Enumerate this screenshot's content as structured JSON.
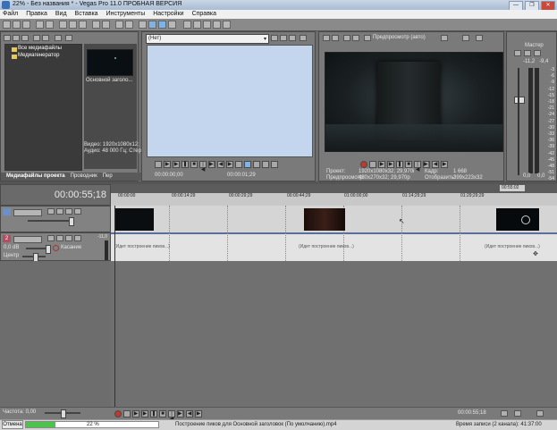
{
  "window": {
    "title": "22% - Без названия * - Vegas Pro 11.0 ПРОБНАЯ ВЕРСИЯ",
    "buttons": [
      "—",
      "❐",
      "✕"
    ]
  },
  "menu": [
    "Файл",
    "Правка",
    "Вид",
    "Вставка",
    "Инструменты",
    "Настройки",
    "Справка"
  ],
  "media_panel": {
    "tree": [
      "Все медиафайлы",
      "Медиагенератор"
    ],
    "thumb_label": "Основной заголо...",
    "info": [
      "Видео: 1920x1080x12;",
      "Аудио: 48 000 Гц; Стер"
    ],
    "tabs": [
      "Медиафайлы проекта",
      "Проводник",
      "Пер"
    ]
  },
  "trimmer": {
    "dropdown": "(Нет)",
    "time_in": "00:00:00;00",
    "time_out": "00:00:01;29"
  },
  "preview": {
    "mode": "Предпросмотр (авто)",
    "info": {
      "project_label": "Проект:",
      "project_value": "1920x1080x32; 29,970i",
      "preview_label": "Предпросмотр:",
      "preview_value": "480x270x32; 29,970p",
      "frame_label": "Кадр:",
      "frame_value": "1 668",
      "display_label": "Отобразить:",
      "display_value": "399x223x32"
    }
  },
  "master": {
    "label": "Мастер",
    "scale": [
      "-3",
      "-6",
      "-9",
      "-12",
      "-15",
      "-18",
      "-21",
      "-24",
      "-27",
      "-30",
      "-33",
      "-36",
      "-39",
      "-42",
      "-45",
      "-48",
      "-51",
      "-54",
      "-57"
    ],
    "top_values": [
      "-11,2",
      "-9,4"
    ],
    "bottom_values": [
      "0,0",
      "0,0"
    ]
  },
  "timeline": {
    "current_time": "00:00:55;18",
    "ruler": [
      "00:00:00",
      "00:00:14:29",
      "00:00:29;29",
      "00:00:44;29",
      "01:00:00;00",
      "01:14;29;29",
      "01:29;29;29"
    ],
    "ruler_marker": "00:55:02",
    "audio_track": {
      "number": "2",
      "level": "0,0 dB",
      "mode": "Касание",
      "pan": "Центр",
      "meter": "-11,0"
    },
    "clip_labels": [
      "(Идет построение пиков...)",
      "(Идет построение пиков...)",
      "(Идет построение пиков...)"
    ]
  },
  "bottom": {
    "rate_label": "Частота: 0,00",
    "end_time": "00:00:55;18"
  },
  "status": {
    "cancel": "Отмена",
    "progress_text": "22 %",
    "progress": 0.22,
    "task": "Построение пиков для Основной заголовок (По умолчанию).mp4",
    "record_time": "Время записи (2 канала): 41:37:00"
  }
}
